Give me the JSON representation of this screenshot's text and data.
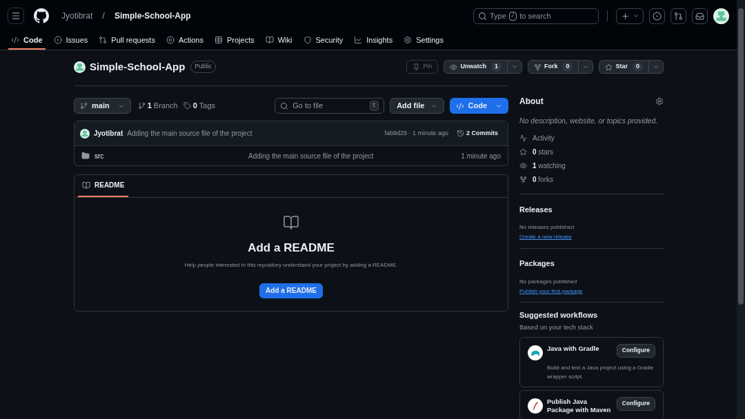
{
  "header": {
    "owner": "Jyotibrat",
    "separator": "/",
    "repo": "Simple-School-App",
    "search": {
      "placeholder_before": "Type",
      "key": "/",
      "placeholder_after": "to search"
    }
  },
  "tabs": [
    {
      "label": "Code",
      "selected": true
    },
    {
      "label": "Issues",
      "selected": false
    },
    {
      "label": "Pull requests",
      "selected": false
    },
    {
      "label": "Actions",
      "selected": false
    },
    {
      "label": "Projects",
      "selected": false
    },
    {
      "label": "Wiki",
      "selected": false
    },
    {
      "label": "Security",
      "selected": false
    },
    {
      "label": "Insights",
      "selected": false
    },
    {
      "label": "Settings",
      "selected": false
    }
  ],
  "repo_title": {
    "name": "Simple-School-App",
    "visibility": "Public"
  },
  "repo_actions": [
    {
      "label": "Pin",
      "disabled": true
    },
    {
      "label": "Unwatch",
      "count": "1",
      "disabled": false
    },
    {
      "label": "Fork",
      "count": "0",
      "disabled": false
    },
    {
      "label": "Star",
      "count": "0",
      "disabled": false
    }
  ],
  "toolbar": {
    "branch": "main",
    "branches_count": "1",
    "branches_label": "Branch",
    "tags_count": "0",
    "tags_label": "Tags",
    "file_search": {
      "placeholder": "Go to file",
      "key": "t"
    },
    "add_file": "Add file",
    "code": "Code"
  },
  "latest_commit": {
    "author": "Jyotibrat",
    "message": "Adding the main source file of the project",
    "hash_time": "fab9d29 · 1 minute ago",
    "commits_count": "2",
    "commits_label": "Commits"
  },
  "files": [
    {
      "name": "src",
      "message": "Adding the main source file of the project",
      "time": "1 minute ago"
    }
  ],
  "readme": {
    "tab": "README",
    "title": "Add a README",
    "text": "Help people interested in this repository understand your project by adding a README.",
    "button": "Add a README"
  },
  "about": {
    "title": "About",
    "description": "No description, website, or topics provided.",
    "stats": [
      {
        "label": "Activity"
      },
      {
        "count": "0",
        "label": "stars"
      },
      {
        "count": "1",
        "label": "watching"
      },
      {
        "count": "0",
        "label": "forks"
      }
    ]
  },
  "releases": {
    "title": "Releases",
    "text": "No releases published",
    "link": "Create a new release"
  },
  "packages": {
    "title": "Packages",
    "text": "No packages published",
    "link": "Publish your first package"
  },
  "workflows": {
    "title": "Suggested workflows",
    "subtitle": "Based on your tech stack",
    "items": [
      {
        "name": "Java with Gradle",
        "description": "Build and test a Java project using a Gradle wrapper script.",
        "button": "Configure"
      },
      {
        "name": "Publish Java Package with Maven",
        "button": "Configure"
      }
    ]
  }
}
